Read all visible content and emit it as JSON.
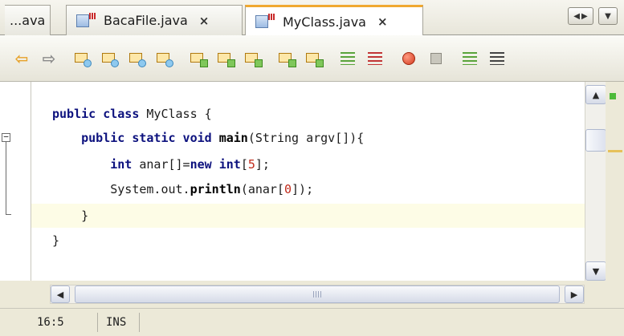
{
  "tabs": {
    "overflow_label": "...ava",
    "items": [
      {
        "label": "BacaFile.java",
        "close": "×",
        "icon": "java-file-icon",
        "active": false
      },
      {
        "label": "MyClass.java",
        "close": "×",
        "icon": "java-file-icon",
        "active": true
      }
    ],
    "nav_icons": [
      "scroll-left-icon",
      "scroll-right-icon",
      "dropdown-icon"
    ],
    "nav_left": "◀",
    "nav_right": "▶",
    "nav_dropdown": "▼"
  },
  "toolbar": {
    "icons": [
      "back-icon",
      "forward-icon",
      "find-selection-icon",
      "find-previous-icon",
      "find-next-icon",
      "toggle-highlight-icon",
      "previous-bookmark-icon",
      "next-bookmark-icon",
      "toggle-bookmark-icon",
      "shift-left-icon",
      "shift-right-icon",
      "comment-icon",
      "uncomment-icon",
      "start-macro-icon",
      "stop-macro-icon",
      "menu-format-icon",
      "more-icon"
    ],
    "back_glyph": "⇦",
    "forward_glyph": "⇨"
  },
  "editor": {
    "lines": [
      {
        "segments": [
          {
            "t": "public class ",
            "c": "kw"
          },
          {
            "t": "MyClass {",
            "c": ""
          }
        ]
      },
      {
        "segments": [
          {
            "t": "    ",
            "c": ""
          },
          {
            "t": "public static void ",
            "c": "kw"
          },
          {
            "t": "main",
            "c": "method"
          },
          {
            "t": "(String argv[]){",
            "c": ""
          }
        ]
      },
      {
        "segments": [
          {
            "t": "        ",
            "c": ""
          },
          {
            "t": "int",
            "c": "kw"
          },
          {
            "t": " anar[]=",
            "c": ""
          },
          {
            "t": "new int",
            "c": "kw"
          },
          {
            "t": "[",
            "c": ""
          },
          {
            "t": "5",
            "c": "num"
          },
          {
            "t": "];",
            "c": ""
          }
        ]
      },
      {
        "segments": [
          {
            "t": "        System.out.",
            "c": ""
          },
          {
            "t": "println",
            "c": "method"
          },
          {
            "t": "(anar[",
            "c": ""
          },
          {
            "t": "0",
            "c": "num"
          },
          {
            "t": "]);",
            "c": ""
          }
        ]
      },
      {
        "segments": [
          {
            "t": "    }",
            "c": ""
          }
        ]
      },
      {
        "segments": [
          {
            "t": "}",
            "c": ""
          }
        ]
      }
    ],
    "current_line_index": 4,
    "fold_glyph": "−"
  },
  "scrollbars": {
    "up": "▲",
    "down": "▼",
    "left": "◀",
    "right": "▶"
  },
  "status": {
    "position": "16:5",
    "mode": "INS"
  }
}
